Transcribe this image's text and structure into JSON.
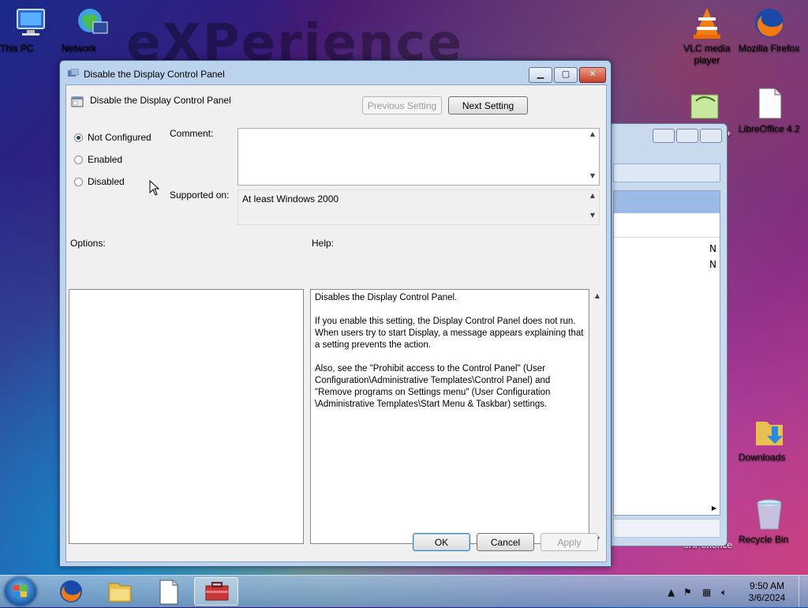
{
  "desktop": {
    "watermark": "eXPerience",
    "icons": [
      {
        "label": "This PC",
        "icon": "this-pc-icon"
      },
      {
        "label": "Network",
        "icon": "network-icon"
      },
      {
        "label": "VLC media player",
        "icon": "vlc-icon"
      },
      {
        "label": "Mozilla Firefox",
        "icon": "firefox-icon"
      },
      {
        "label": "LibreOffice 4.2",
        "icon": "libreoffice-icon"
      },
      {
        "label": "Downloads",
        "icon": "downloads-folder-icon"
      },
      {
        "label": "Recycle Bin",
        "icon": "recycle-bin-icon"
      }
    ],
    "partial_label": "+",
    "partial_label_2": "eXPerience"
  },
  "background_window": {
    "rows": [
      "N",
      "N"
    ]
  },
  "dialog": {
    "window_title": "Disable the Display Control Panel",
    "setting_title": "Disable the Display Control Panel",
    "previous_setting_label": "Previous Setting",
    "next_setting_label": "Next Setting",
    "radio_not_configured": "Not Configured",
    "radio_enabled": "Enabled",
    "radio_disabled": "Disabled",
    "selected_option": "Not Configured",
    "comment_label": "Comment:",
    "comment_value": "",
    "supported_on_label": "Supported on:",
    "supported_on_value": "At least Windows 2000",
    "options_label": "Options:",
    "help_label": "Help:",
    "help_text": "Disables the Display Control Panel.\n\nIf you enable this setting, the Display Control Panel does not run. When users try to start Display, a message appears explaining that a setting prevents the action.\n\nAlso, see the \"Prohibit access to the Control Panel\" (User Configuration\\Administrative Templates\\Control Panel) and \"Remove programs on Settings menu\" (User Configuration \\Administrative Templates\\Start Menu & Taskbar) settings.",
    "ok_label": "OK",
    "cancel_label": "Cancel",
    "apply_label": "Apply"
  },
  "taskbar": {
    "time": "9:50 AM",
    "date": "3/6/2024",
    "items": [
      "firefox-icon",
      "file-explorer-icon",
      "libreoffice-document-icon",
      "group-policy-editor-icon"
    ]
  }
}
